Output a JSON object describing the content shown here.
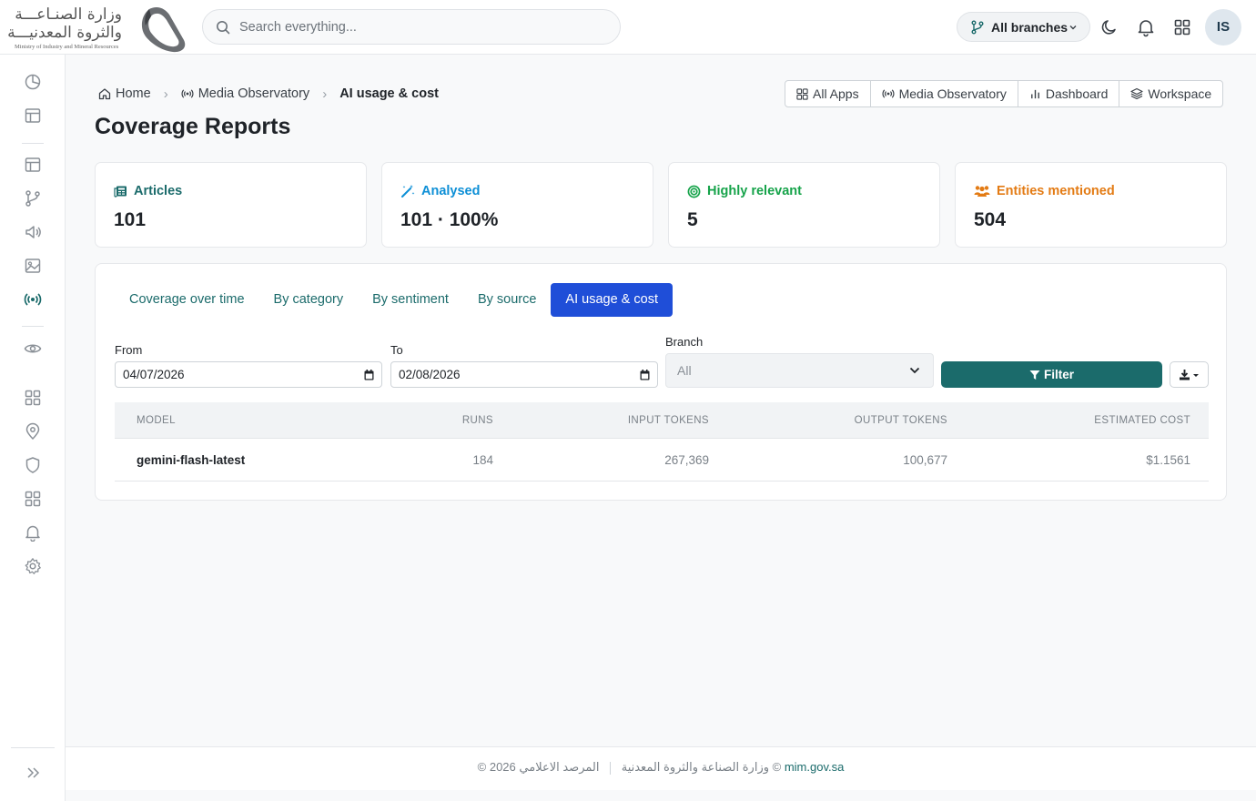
{
  "logo": {
    "arabic_line1": "وزارة الصنـاعـــة",
    "arabic_line2": "والثروة المعدنيـــة",
    "english": "Ministry of Industry and Mineral Resources"
  },
  "search": {
    "placeholder": "Search everything..."
  },
  "header": {
    "branch_selector": "All branches",
    "avatar_initials": "IS"
  },
  "breadcrumb": {
    "home": "Home",
    "section": "Media Observatory",
    "current": "AI usage & cost"
  },
  "quicklinks": [
    "All Apps",
    "Media Observatory",
    "Dashboard",
    "Workspace"
  ],
  "page_title": "Coverage Reports",
  "stats": [
    {
      "label": "Articles",
      "value": "101",
      "color": "#1b6b6b",
      "icon": "newspaper-icon"
    },
    {
      "label": "Analysed",
      "value": "101 · 100%",
      "color": "#0d8fd6",
      "icon": "magic-wand-icon"
    },
    {
      "label": "Highly relevant",
      "value": "5",
      "color": "#16a34a",
      "icon": "target-icon"
    },
    {
      "label": "Entities mentioned",
      "value": "504",
      "color": "#e37b14",
      "icon": "people-icon"
    }
  ],
  "tabs": [
    "Coverage over time",
    "By category",
    "By sentiment",
    "By source",
    "AI usage & cost"
  ],
  "active_tab": "AI usage & cost",
  "filters": {
    "from_label": "From",
    "from_value": "04/07/2026",
    "to_label": "To",
    "to_value": "02/08/2026",
    "branch_label": "Branch",
    "branch_value": "All",
    "filter_button": "Filter"
  },
  "table": {
    "columns": [
      "MODEL",
      "RUNS",
      "INPUT TOKENS",
      "OUTPUT TOKENS",
      "ESTIMATED COST"
    ],
    "rows": [
      {
        "model": "gemini-flash-latest",
        "runs": "184",
        "input_tokens": "267,369",
        "output_tokens": "100,677",
        "estimated_cost": "$1.1561"
      }
    ]
  },
  "footer": {
    "copyright": "© 2026 وزارة الصناعة والثروة المعدنية",
    "observatory": "المرصد الاعلامي ©",
    "link": "mim.gov.sa"
  },
  "colors": {
    "accent": "#1b6b6b",
    "active_tab": "#1f4ed8"
  }
}
